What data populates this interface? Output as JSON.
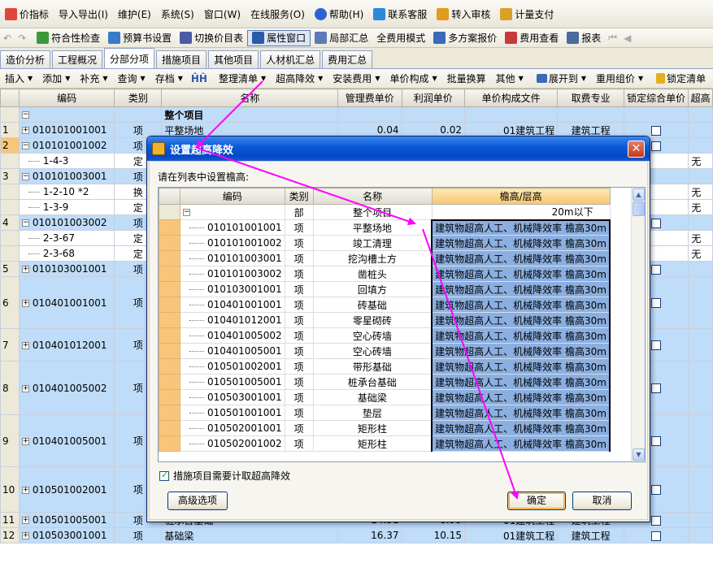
{
  "menubar": {
    "items": [
      {
        "label": "价指标",
        "icon": "indicator-icon"
      },
      {
        "label": "导入导出(I)",
        "icon": ""
      },
      {
        "label": "维护(E)",
        "icon": ""
      },
      {
        "label": "系统(S)",
        "icon": ""
      },
      {
        "label": "窗口(W)",
        "icon": ""
      },
      {
        "label": "在线服务(O)",
        "icon": ""
      },
      {
        "label": "帮助(H)",
        "icon": "help-icon"
      },
      {
        "label": "联系客服",
        "icon": "customer-service-icon"
      },
      {
        "label": "转入审核",
        "icon": "audit-icon"
      },
      {
        "label": "计量支付",
        "icon": "payment-icon"
      }
    ]
  },
  "toolbar1": {
    "items": [
      {
        "label": "符合性检查",
        "icon": "check-icon"
      },
      {
        "label": "预算书设置",
        "icon": "settings-icon"
      },
      {
        "label": "切换价目表",
        "icon": "switch-icon"
      },
      {
        "label": "属性窗口",
        "icon": "property-window-icon"
      },
      {
        "label": "局部汇总",
        "icon": "partial-summary-icon"
      },
      {
        "label": "全费用模式",
        "icon": ""
      },
      {
        "label": "多方案报价",
        "icon": "multi-plan-icon"
      },
      {
        "label": "费用查看",
        "icon": "cost-view-icon"
      },
      {
        "label": "报表",
        "icon": "report-icon"
      }
    ]
  },
  "tabs": [
    "造价分析",
    "工程概况",
    "分部分项",
    "措施项目",
    "其他项目",
    "人材机汇总",
    "费用汇总"
  ],
  "active_tab": "分部分项",
  "toolbar2": {
    "items": [
      "插入",
      "添加",
      "补充",
      "查询",
      "存档",
      "整理清单",
      "超高降效",
      "安装费用",
      "单价构成",
      "批量换算",
      "其他",
      "展开到",
      "重用组价",
      "锁定清单"
    ]
  },
  "grid": {
    "headers": [
      "编码",
      "类别",
      "名称",
      "管理费单价",
      "利润单价",
      "单价构成文件",
      "取费专业",
      "锁定综合单价",
      "超高"
    ],
    "top_row": {
      "name": "整个项目"
    },
    "rows": [
      {
        "num": "1",
        "exp": "+",
        "code": "010101001001",
        "type": "项",
        "name": "平整场地",
        "mgmt": "0.04",
        "profit": "0.02",
        "file": "01建筑工程",
        "spec": "建筑工程",
        "style": "blue",
        "cb": true
      },
      {
        "num": "2",
        "exp": "−",
        "code": "010101001002",
        "type": "项",
        "name": "",
        "mgmt": "",
        "profit": "",
        "file": "",
        "spec": "",
        "style": "blue sel",
        "cb": true
      },
      {
        "num": "",
        "exp": "",
        "code": "1-4-3",
        "type": "定",
        "name": "",
        "mgmt": "",
        "profit": "",
        "file": "",
        "spec": "",
        "style": "white",
        "last": "无"
      },
      {
        "num": "3",
        "exp": "−",
        "code": "010101003001",
        "type": "项",
        "name": "",
        "mgmt": "",
        "profit": "",
        "file": "",
        "spec": "",
        "style": "blue"
      },
      {
        "num": "",
        "exp": "",
        "code": "1-2-10 *2",
        "type": "换",
        "name": "",
        "mgmt": "",
        "profit": "",
        "file": "",
        "spec": "",
        "style": "white",
        "last": "无"
      },
      {
        "num": "",
        "exp": "",
        "code": "1-3-9",
        "type": "定",
        "name": "",
        "mgmt": "",
        "profit": "",
        "file": "",
        "spec": "",
        "style": "white",
        "last": "无"
      },
      {
        "num": "4",
        "exp": "−",
        "code": "010101003002",
        "type": "项",
        "name": "",
        "mgmt": "",
        "profit": "",
        "file": "",
        "spec": "",
        "style": "blue",
        "cb": true
      },
      {
        "num": "",
        "exp": "",
        "code": "2-3-67",
        "type": "定",
        "name": "",
        "mgmt": "",
        "profit": "",
        "file": "",
        "spec": "",
        "style": "white",
        "last": "无"
      },
      {
        "num": "",
        "exp": "",
        "code": "2-3-68",
        "type": "定",
        "name": "",
        "mgmt": "",
        "profit": "",
        "file": "",
        "spec": "",
        "style": "white",
        "last": "无"
      },
      {
        "num": "5",
        "exp": "+",
        "code": "010103001001",
        "type": "项",
        "name": "",
        "mgmt": "",
        "profit": "",
        "file": "",
        "spec": "",
        "style": "blue",
        "cb": true
      },
      {
        "num": "6",
        "exp": "+",
        "code": "010401001001",
        "type": "项",
        "name": "",
        "mgmt": "",
        "profit": "",
        "file": "",
        "spec": "",
        "style": "blue",
        "cb": true
      },
      {
        "num": "7",
        "exp": "+",
        "code": "010401012001",
        "type": "项",
        "name": "",
        "mgmt": "",
        "profit": "",
        "file": "",
        "spec": "",
        "style": "blue",
        "cb": true
      },
      {
        "num": "8",
        "exp": "+",
        "code": "010401005002",
        "type": "项",
        "name": "",
        "mgmt": "",
        "profit": "",
        "file": "",
        "spec": "",
        "style": "blue",
        "cb": true
      },
      {
        "num": "9",
        "exp": "+",
        "code": "010401005001",
        "type": "项",
        "name": "",
        "mgmt": "",
        "profit": "",
        "file": "",
        "spec": "",
        "style": "blue",
        "cb": true
      },
      {
        "num": "10",
        "exp": "+",
        "code": "010501002001",
        "type": "项",
        "name": "",
        "mgmt": "",
        "profit": "",
        "file": "",
        "spec": "",
        "style": "blue",
        "cb": true
      },
      {
        "num": "11",
        "exp": "+",
        "code": "010501005001",
        "type": "项",
        "name": "桩承台基础",
        "mgmt": "14.51",
        "profit": "8.99",
        "file": "01建筑工程",
        "spec": "建筑工程",
        "style": "blue",
        "cb": true
      },
      {
        "num": "12",
        "exp": "+",
        "code": "010503001001",
        "type": "项",
        "name": "基础梁",
        "mgmt": "16.37",
        "profit": "10.15",
        "file": "01建筑工程",
        "spec": "建筑工程",
        "style": "blue",
        "cb": true
      }
    ]
  },
  "dialog": {
    "title": "设置超高降效",
    "prompt": "请在列表中设置檐高:",
    "headers": [
      "编码",
      "类别",
      "名称",
      "檐高/层高"
    ],
    "top_row": {
      "type": "部",
      "name": "整个项目",
      "height": "20m以下"
    },
    "rows": [
      {
        "code": "010101001001",
        "type": "项",
        "name": "平整场地",
        "height": "建筑物超高人工、机械降效率 檐高30m"
      },
      {
        "code": "010101001002",
        "type": "项",
        "name": "竣工清理",
        "height": "建筑物超高人工、机械降效率 檐高30m"
      },
      {
        "code": "010101003001",
        "type": "项",
        "name": "挖沟槽土方",
        "height": "建筑物超高人工、机械降效率 檐高30m"
      },
      {
        "code": "010101003002",
        "type": "项",
        "name": "凿桩头",
        "height": "建筑物超高人工、机械降效率 檐高30m"
      },
      {
        "code": "010103001001",
        "type": "项",
        "name": "回填方",
        "height": "建筑物超高人工、机械降效率 檐高30m"
      },
      {
        "code": "010401001001",
        "type": "项",
        "name": "砖基础",
        "height": "建筑物超高人工、机械降效率 檐高30m"
      },
      {
        "code": "010401012001",
        "type": "项",
        "name": "零星砌砖",
        "height": "建筑物超高人工、机械降效率 檐高30m"
      },
      {
        "code": "010401005002",
        "type": "项",
        "name": "空心砖墙",
        "height": "建筑物超高人工、机械降效率 檐高30m"
      },
      {
        "code": "010401005001",
        "type": "项",
        "name": "空心砖墙",
        "height": "建筑物超高人工、机械降效率 檐高30m"
      },
      {
        "code": "010501002001",
        "type": "项",
        "name": "带形基础",
        "height": "建筑物超高人工、机械降效率 檐高30m"
      },
      {
        "code": "010501005001",
        "type": "项",
        "name": "桩承台基础",
        "height": "建筑物超高人工、机械降效率 檐高30m"
      },
      {
        "code": "010503001001",
        "type": "项",
        "name": "基础梁",
        "height": "建筑物超高人工、机械降效率 檐高30m"
      },
      {
        "code": "010501001001",
        "type": "项",
        "name": "垫层",
        "height": "建筑物超高人工、机械降效率 檐高30m"
      },
      {
        "code": "010502001001",
        "type": "项",
        "name": "矩形柱",
        "height": "建筑物超高人工、机械降效率 檐高30m"
      },
      {
        "code": "010502001002",
        "type": "项",
        "name": "矩形柱",
        "height": "建筑物超高人工、机械降效率 檐高30m"
      }
    ],
    "checkbox_label": "措施项目需要计取超高降效",
    "checkbox_checked": true,
    "advanced_button": "高级选项",
    "ok_button": "确定",
    "cancel_button": "取消"
  },
  "colors": {
    "row_blue": "#bfdcf8",
    "height_cell": "#8bafe0",
    "annotation_arrow": "#ff00ff",
    "title_bar": "#0a5cd8"
  }
}
